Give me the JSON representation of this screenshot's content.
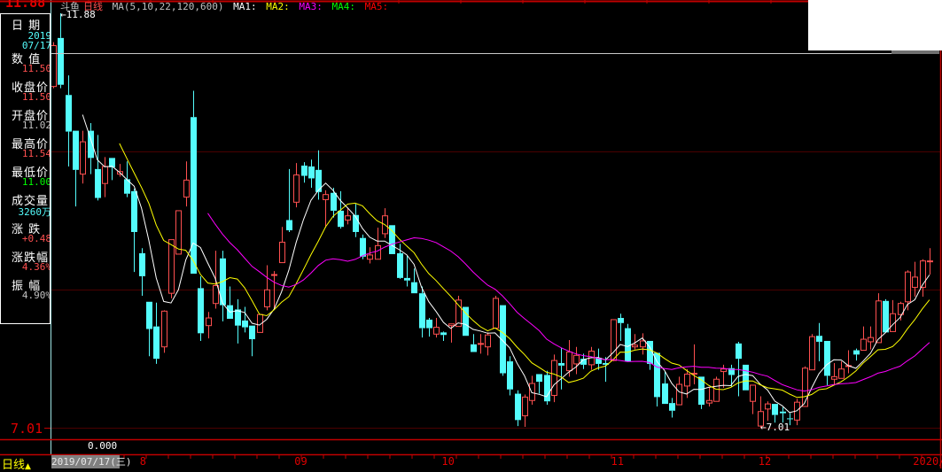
{
  "header": {
    "stock_name": "斗鱼",
    "period": "日线",
    "ma_params": "MA(5,10,22,120,600)",
    "ma_labels": [
      {
        "label": "MA1:",
        "color": "#ffffff"
      },
      {
        "label": "MA2:",
        "color": "#ffff00"
      },
      {
        "label": "MA3:",
        "color": "#ff00ff"
      },
      {
        "label": "MA4:",
        "color": "#00ff00"
      },
      {
        "label": "MA5:",
        "color": "#ff0000"
      }
    ]
  },
  "info_panel": {
    "date_label": "日 期",
    "date_year": "2019",
    "date_md": "07/17",
    "items": [
      {
        "label": "数 值",
        "value": "11.50",
        "color": "#ff5050"
      },
      {
        "label": "收盘价",
        "value": "11.50",
        "color": "#ff5050"
      },
      {
        "label": "开盘价",
        "value": "11.02",
        "color": "#c0c0c0"
      },
      {
        "label": "最高价",
        "value": "11.54",
        "color": "#ff5050"
      },
      {
        "label": "最低价",
        "value": "11.00",
        "color": "#00ff00"
      },
      {
        "label": "成交量",
        "value": "3260万",
        "color": "#54fcfc"
      },
      {
        "label": "涨 跌",
        "value": "+0.48",
        "color": "#ff5050"
      },
      {
        "label": "涨跌幅",
        "value": "4.36%",
        "color": "#ff5050"
      },
      {
        "label": "振 幅",
        "value": "4.90%",
        "color": "#c0c0c0"
      }
    ]
  },
  "axis": {
    "top_price": "11.88",
    "bottom_price": "7.01",
    "volume_zero": "0.000"
  },
  "footer": {
    "period_switch": "日线",
    "period_switch_icon": "▲",
    "cursor_date": "2019/07/17(三)",
    "month_labels": [
      "8",
      "09",
      "10",
      "11",
      "12",
      "2020/"
    ]
  },
  "colors": {
    "up": "#ff5050",
    "down": "#54fcfc",
    "ma5": "#ffffff",
    "ma10": "#ffff00",
    "ma22": "#ff00ff",
    "grid": "#4a0000",
    "frame": "#c00000"
  },
  "chart_data": {
    "type": "candlestick",
    "title": "斗鱼 日线",
    "moving_averages": [
      5,
      10,
      22
    ],
    "high_marker": "11.88",
    "low_marker": "7.01",
    "ylim": [
      7.01,
      11.88
    ],
    "x_tick_labels": [
      "8",
      "09",
      "10",
      "11",
      "12",
      "2020/"
    ],
    "first_date": "2019/07/17",
    "ohlc": [
      [
        11.02,
        11.54,
        11.0,
        11.5
      ],
      [
        11.59,
        11.88,
        11.0,
        11.04
      ],
      [
        10.92,
        11.15,
        10.08,
        10.49
      ],
      [
        10.5,
        10.5,
        9.61,
        10.04
      ],
      [
        9.99,
        10.5,
        9.88,
        10.37
      ],
      [
        10.5,
        10.59,
        9.99,
        10.18
      ],
      [
        10.05,
        10.45,
        9.68,
        9.71
      ],
      [
        9.88,
        10.19,
        9.72,
        10.08
      ],
      [
        10.18,
        10.18,
        9.92,
        10.07
      ],
      [
        9.99,
        10.11,
        9.96,
        10.02
      ],
      [
        9.93,
        10.14,
        9.72,
        9.76
      ],
      [
        9.79,
        9.82,
        8.84,
        9.31
      ],
      [
        9.06,
        9.12,
        8.56,
        8.79
      ],
      [
        8.49,
        8.49,
        7.85,
        8.17
      ],
      [
        8.2,
        8.48,
        7.76,
        7.82
      ],
      [
        7.96,
        8.39,
        7.89,
        8.38
      ],
      [
        8.59,
        9.22,
        8.53,
        9.22
      ],
      [
        9.05,
        9.56,
        9.05,
        9.56
      ],
      [
        9.72,
        10.14,
        9.61,
        9.92
      ],
      [
        10.66,
        10.97,
        8.82,
        8.82
      ],
      [
        8.65,
        8.79,
        8.03,
        8.12
      ],
      [
        8.21,
        8.37,
        8.06,
        8.3
      ],
      [
        8.47,
        9.09,
        8.41,
        8.68
      ],
      [
        9.0,
        9.09,
        8.26,
        8.45
      ],
      [
        8.45,
        8.67,
        8.29,
        8.29
      ],
      [
        8.4,
        8.52,
        8.0,
        8.21
      ],
      [
        8.27,
        8.43,
        8.13,
        8.19
      ],
      [
        8.21,
        8.21,
        7.85,
        8.05
      ],
      [
        8.13,
        8.34,
        8.13,
        8.34
      ],
      [
        8.43,
        8.92,
        8.39,
        8.63
      ],
      [
        8.8,
        8.85,
        8.41,
        8.81
      ],
      [
        8.95,
        9.37,
        8.95,
        9.19
      ],
      [
        9.45,
        10.05,
        9.31,
        9.33
      ],
      [
        9.66,
        10.12,
        9.6,
        9.98
      ],
      [
        10.09,
        10.13,
        9.89,
        9.97
      ],
      [
        10.08,
        10.16,
        9.83,
        9.94
      ],
      [
        10.04,
        10.27,
        9.69,
        9.78
      ],
      [
        9.69,
        9.8,
        9.36,
        9.75
      ],
      [
        9.77,
        9.83,
        9.48,
        9.56
      ],
      [
        9.56,
        9.79,
        9.35,
        9.37
      ],
      [
        9.45,
        9.59,
        9.4,
        9.5
      ],
      [
        9.51,
        9.64,
        9.25,
        9.31
      ],
      [
        9.24,
        9.28,
        8.99,
        9.02
      ],
      [
        8.99,
        9.13,
        8.94,
        9.04
      ],
      [
        8.99,
        9.36,
        8.99,
        9.15
      ],
      [
        9.29,
        9.59,
        9.24,
        9.5
      ],
      [
        9.39,
        9.39,
        9.05,
        9.05
      ],
      [
        9.06,
        9.17,
        8.76,
        8.77
      ],
      [
        8.77,
        9.03,
        8.67,
        8.74
      ],
      [
        8.72,
        8.88,
        8.59,
        8.59
      ],
      [
        8.59,
        8.67,
        8.07,
        8.18
      ],
      [
        8.28,
        8.3,
        8.08,
        8.18
      ],
      [
        8.11,
        8.3,
        8.07,
        8.19
      ],
      [
        8.13,
        8.14,
        8.03,
        8.1
      ],
      [
        8.21,
        8.23,
        8.01,
        8.23
      ],
      [
        8.2,
        8.56,
        8.2,
        8.51
      ],
      [
        8.43,
        8.43,
        8.09,
        8.09
      ],
      [
        7.99,
        8.11,
        7.9,
        7.9
      ],
      [
        7.99,
        8.11,
        7.88,
        8.0
      ],
      [
        7.96,
        8.13,
        7.86,
        8.1
      ],
      [
        8.18,
        8.56,
        8.18,
        8.53
      ],
      [
        8.45,
        8.45,
        7.62,
        7.65
      ],
      [
        7.79,
        7.85,
        7.39,
        7.46
      ],
      [
        7.41,
        7.45,
        7.03,
        7.1
      ],
      [
        7.15,
        7.4,
        7.02,
        7.37
      ],
      [
        7.33,
        7.62,
        7.28,
        7.53
      ],
      [
        7.64,
        7.64,
        7.41,
        7.55
      ],
      [
        7.63,
        7.68,
        7.28,
        7.32
      ],
      [
        7.39,
        7.87,
        7.31,
        7.8
      ],
      [
        7.77,
        7.95,
        7.46,
        7.74
      ],
      [
        7.68,
        8.04,
        7.61,
        7.9
      ],
      [
        7.76,
        7.96,
        7.64,
        7.86
      ],
      [
        7.82,
        7.88,
        7.7,
        7.75
      ],
      [
        7.75,
        7.96,
        7.69,
        7.91
      ],
      [
        7.83,
        7.94,
        7.69,
        7.76
      ],
      [
        7.77,
        7.84,
        7.55,
        7.75
      ],
      [
        7.8,
        8.28,
        7.79,
        8.28
      ],
      [
        8.3,
        8.35,
        8.03,
        8.24
      ],
      [
        8.18,
        8.23,
        7.79,
        7.79
      ],
      [
        7.96,
        8.11,
        7.93,
        7.98
      ],
      [
        7.96,
        8.12,
        7.87,
        8.03
      ],
      [
        8.03,
        8.03,
        7.69,
        7.76
      ],
      [
        7.89,
        7.89,
        7.26,
        7.37
      ],
      [
        7.53,
        7.67,
        7.29,
        7.29
      ],
      [
        7.3,
        7.36,
        7.13,
        7.21
      ],
      [
        7.28,
        7.61,
        7.28,
        7.52
      ],
      [
        7.5,
        7.7,
        7.36,
        7.64
      ],
      [
        7.64,
        7.99,
        7.52,
        7.65
      ],
      [
        7.61,
        7.61,
        7.23,
        7.28
      ],
      [
        7.3,
        7.49,
        7.26,
        7.33
      ],
      [
        7.32,
        7.61,
        7.32,
        7.58
      ],
      [
        7.67,
        7.75,
        7.48,
        7.7
      ],
      [
        7.71,
        7.75,
        7.49,
        7.63
      ],
      [
        8.0,
        8.02,
        7.38,
        7.82
      ],
      [
        7.75,
        7.75,
        7.45,
        7.45
      ],
      [
        7.32,
        7.51,
        7.17,
        7.51
      ],
      [
        7.03,
        7.38,
        7.01,
        7.2
      ],
      [
        7.23,
        7.32,
        7.09,
        7.29
      ],
      [
        7.29,
        7.29,
        7.07,
        7.16
      ],
      [
        7.2,
        7.25,
        7.07,
        7.18
      ],
      [
        7.12,
        7.18,
        7.04,
        7.11
      ],
      [
        7.1,
        7.35,
        7.04,
        7.31
      ],
      [
        7.26,
        7.73,
        7.26,
        7.71
      ],
      [
        7.69,
        8.11,
        7.69,
        8.08
      ],
      [
        8.09,
        8.24,
        7.79,
        8.02
      ],
      [
        8.03,
        8.03,
        7.51,
        7.62
      ],
      [
        7.58,
        7.77,
        7.51,
        7.61
      ],
      [
        7.59,
        7.79,
        7.59,
        7.7
      ],
      [
        7.73,
        7.92,
        7.65,
        7.74
      ],
      [
        7.92,
        7.94,
        7.8,
        7.87
      ],
      [
        7.92,
        8.2,
        7.92,
        8.05
      ],
      [
        8.02,
        8.2,
        7.93,
        8.07
      ],
      [
        8.01,
        8.59,
        8.01,
        8.5
      ],
      [
        8.5,
        8.52,
        8.13,
        8.13
      ],
      [
        8.14,
        8.51,
        8.14,
        8.35
      ],
      [
        8.34,
        8.49,
        8.27,
        8.47
      ],
      [
        8.49,
        8.86,
        8.39,
        8.84
      ],
      [
        8.66,
        8.96,
        8.55,
        8.78
      ],
      [
        8.66,
        8.99,
        8.55,
        8.97
      ],
      [
        8.96,
        9.12,
        8.81,
        8.97
      ]
    ]
  }
}
